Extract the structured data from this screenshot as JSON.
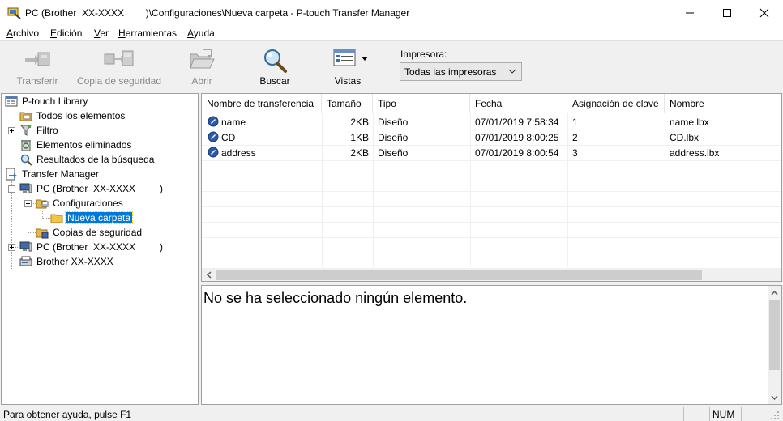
{
  "window": {
    "title": "PC (Brother  XX-XXXX        )\\Configuraciones\\Nueva carpeta - P-touch Transfer Manager",
    "controls": [
      "minimize-icon",
      "maximize-icon",
      "close-icon"
    ]
  },
  "menu": {
    "items": [
      {
        "first": "A",
        "rest": "rchivo"
      },
      {
        "first": "E",
        "rest": "dición"
      },
      {
        "first": "V",
        "rest": "er"
      },
      {
        "first": "H",
        "rest": "erramientas"
      },
      {
        "first": "A",
        "rest": "yuda"
      }
    ]
  },
  "toolbar": {
    "transfer": "Transferir",
    "backup": "Copia de seguridad",
    "open": "Abrir",
    "search": "Buscar",
    "views": "Vistas",
    "printer_label": "Impresora:",
    "printer_value": "Todas las impresoras"
  },
  "tree": {
    "library": "P-touch Library",
    "all_items": "Todos los elementos",
    "filter": "Filtro",
    "deleted": "Elementos eliminados",
    "search_results": "Resultados de la búsqueda",
    "transfer_manager": "Transfer Manager",
    "pc1": "PC (Brother  XX-XXXX         )",
    "configurations": "Configuraciones",
    "new_folder": "Nueva carpeta",
    "backups": "Copias de seguridad",
    "pc2": "PC (Brother  XX-XXXX         )",
    "printer": "Brother XX-XXXX"
  },
  "list": {
    "columns": {
      "name": "Nombre de transferencia",
      "size": "Tamaño",
      "type": "Tipo",
      "date": "Fecha",
      "key": "Asignación de clave",
      "filename": "Nombre"
    },
    "rows": [
      {
        "name": "name",
        "size": "2KB",
        "type": "Diseño",
        "date": "07/01/2019 7:58:34",
        "key": "1",
        "filename": "name.lbx"
      },
      {
        "name": "CD",
        "size": "1KB",
        "type": "Diseño",
        "date": "07/01/2019 8:00:25",
        "key": "2",
        "filename": "CD.lbx"
      },
      {
        "name": "address",
        "size": "2KB",
        "type": "Diseño",
        "date": "07/01/2019 8:00:54",
        "key": "3",
        "filename": "address.lbx"
      }
    ]
  },
  "preview": {
    "message": "No se ha seleccionado ningún elemento."
  },
  "status": {
    "help": "Para obtener ayuda, pulse F1",
    "num": "NUM"
  },
  "colors": {
    "selection": "#0078d7",
    "folder": "#f5c542"
  }
}
